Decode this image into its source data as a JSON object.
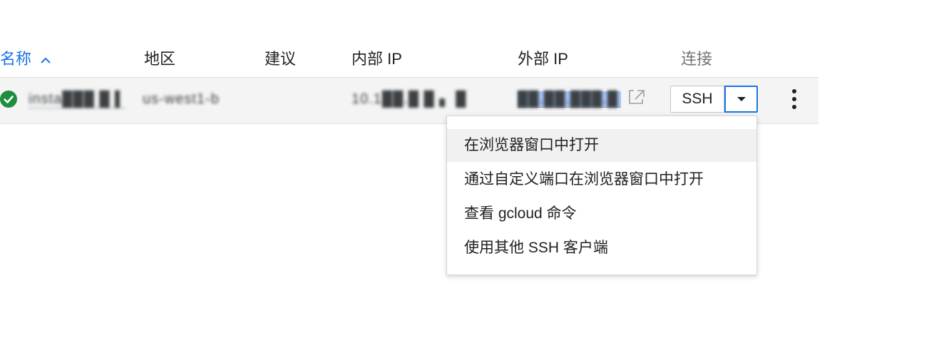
{
  "table": {
    "headers": {
      "name": "名称",
      "zone": "地区",
      "recommendation": "建议",
      "internal_ip": "内部 IP",
      "external_ip": "外部 IP",
      "connect": "连接"
    },
    "sort": {
      "column": "name",
      "direction": "ascending"
    },
    "rows": [
      {
        "status": "running",
        "name": "insta███ █ ▌",
        "zone": "us-west1-b",
        "recommendation": "",
        "internal_ip": "10.1██.█ █ ▖ █",
        "external_ip": "██.██.███.█"
      }
    ]
  },
  "connect": {
    "ssh_label": "SSH"
  },
  "ssh_menu": {
    "items": [
      "在浏览器窗口中打开",
      "通过自定义端口在浏览器窗口中打开",
      "查看 gcloud 命令",
      "使用其他 SSH 客户端"
    ],
    "hovered_index": 0
  },
  "colors": {
    "accent": "#1a73e8",
    "status_ok": "#1e8e3e",
    "ip_highlight": "#a8c7fa",
    "row_bg": "#f4f4f4"
  },
  "icons": {
    "sort": "arrow-up-chevron-icon",
    "status": "check-circle-icon",
    "external_link": "open-in-new-icon",
    "dropdown": "caret-down-icon",
    "more": "more-vert-icon"
  }
}
